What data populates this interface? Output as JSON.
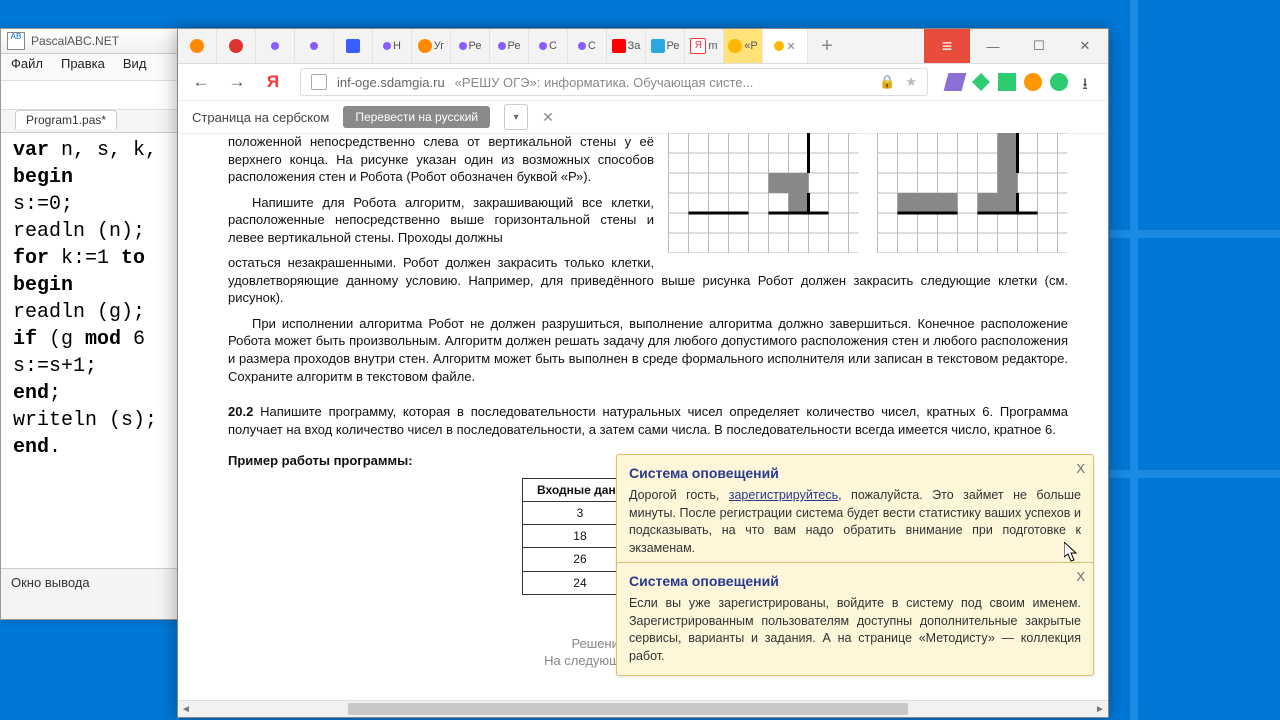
{
  "pascal": {
    "title": "PascalABC.NET",
    "menu": [
      "Файл",
      "Правка",
      "Вид"
    ],
    "tab": "Program1.pas*",
    "code": "var n, s, k,\nbegin\ns:=0;\nreadln (n);\nfor k:=1 to\nbegin\nreadln (g);\nif (g mod 6\ns:=s+1;\nend;\nwriteln (s);\nend.",
    "output_label": "Окно вывода"
  },
  "browser": {
    "tabs": [
      {
        "label": "",
        "color": "#ff8a00"
      },
      {
        "label": "",
        "color": "#d33"
      },
      {
        "label": "",
        "color": "#8a5cff"
      },
      {
        "label": "",
        "color": "#8a5cff"
      },
      {
        "label": "",
        "color": "#3b5cff"
      },
      {
        "label": "Н",
        "color": "#8a5cff"
      },
      {
        "label": "Уг",
        "color": "#ff8a00"
      },
      {
        "label": "Ре",
        "color": "#8a5cff"
      },
      {
        "label": "Ре",
        "color": "#8a5cff"
      },
      {
        "label": "С",
        "color": "#8a5cff"
      },
      {
        "label": "С",
        "color": "#8a5cff"
      },
      {
        "label": "За",
        "color": "#f00"
      },
      {
        "label": "Ре",
        "color": "#2aa8e0"
      },
      {
        "label": "m",
        "color": "#f33"
      },
      {
        "label": "«Р",
        "color": "#ffb800"
      }
    ],
    "active_tab_bg": "#ffe27a",
    "url_host": "inf-oge.sdamgia.ru",
    "url_title": "«РЕШУ ОГЭ»: информатика. Обучающая систе...",
    "translate_label": "Страница на сербском",
    "translate_button": "Перевести на русский"
  },
  "page": {
    "float_text_1": "положенной непосредственно слева от вертикальной стены у её верхнего конца. На рисунке указан один из возможных способов расположения стен и Робота (Робот обозначен буквой «Р»).",
    "float_text_2": "Напишите для Робота алгоритм, закрашивающий все клетки, расположенные непосредственно выше горизонтальной стены и левее вертикальной стены. Проходы должны",
    "full_text_1": "остаться незакрашенными. Робот должен закрасить только клетки, удовлетворяющие данному условию. Например, для приведённого выше рисунка Робот должен закрасить следующие клетки (см. рисунок).",
    "full_text_2": "При исполнении алгоритма Робот не должен разрушиться, выполнение алгоритма должно завершиться. Конечное расположение Робота может быть произвольным. Алгоритм должен решать задачу для любого допустимого расположения стен и любого расположения и размера проходов внутри стен. Алгоритм может быть выполнен в среде формального исполнителя или записан в текстовом редакторе. Сохраните алгоритм в текстовом файле.",
    "task_number": "20.2",
    "task_text": " Напишите программу, которая в последовательности натуральных чисел определяет количество чисел, кратных 6. Программа получает на вход количество чисел в последовательности, а затем сами числа. В последовательности всегда имеется число, кратное 6.",
    "example_label": "Пример работы программы:",
    "table_header": "Входные данн",
    "table_rows": [
      "3",
      "18",
      "26",
      "24"
    ],
    "footer_1": "Решения заданий части (",
    "footer_2": "На следующей странице вам буде"
  },
  "notif1": {
    "title": "Система оповещений",
    "greeting_pre": "Дорогой гость, ",
    "link": "зарегистрируйтесь",
    "greeting_post": ", пожалуйста. Это займет не больше минуты. После регистрации система будет вести статистику ваших успехов и подсказывать, на что вам надо обратить внимание при подготовке к экзаменам.",
    "close": "X"
  },
  "notif2": {
    "title": "Система оповещений",
    "body": "Если вы уже зарегистрированы, войдите в систему под своим именем. Зарегистрированным пользователям доступны дополнительные закрытые сервисы, варианты и задания. А на странице «Методисту» — коллекция работ.",
    "close": "X"
  }
}
